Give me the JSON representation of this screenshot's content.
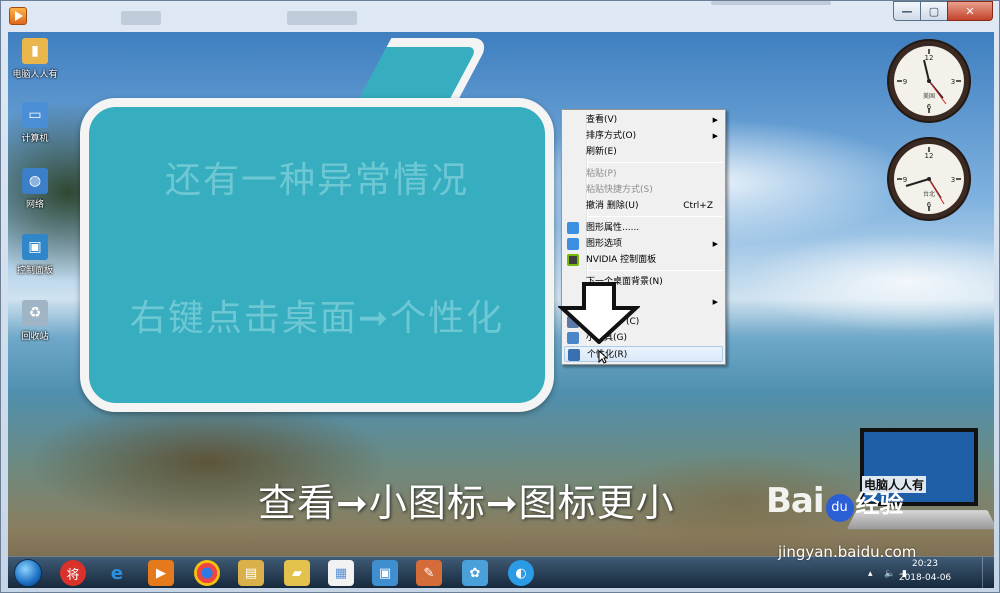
{
  "desktop_icons": [
    {
      "label": "电脑人人有",
      "icon": "folder-icon",
      "color": "#e8b64a"
    },
    {
      "label": "计算机",
      "icon": "computer-icon",
      "color": "#4a8ed6"
    },
    {
      "label": "网络",
      "icon": "network-icon",
      "color": "#3c7fc9"
    },
    {
      "label": "控制面板",
      "icon": "control-panel-icon",
      "color": "#2f86c8"
    },
    {
      "label": "回收站",
      "icon": "recycle-bin-icon",
      "color": "#9fb4c4"
    }
  ],
  "bubble": {
    "line1": "还有一种异常情况",
    "line2": "右键点击桌面➞个性化"
  },
  "context_menu": {
    "items": [
      {
        "label": "查看(V)",
        "submenu": true
      },
      {
        "label": "排序方式(O)",
        "submenu": true
      },
      {
        "label": "刷新(E)"
      },
      {
        "label": "粘贴(P)",
        "disabled": true
      },
      {
        "label": "粘贴快捷方式(S)",
        "disabled": true
      },
      {
        "label": "撤消 删除(U)",
        "shortcut": "Ctrl+Z"
      },
      {
        "label": "图形属性......",
        "icon": "graphics-properties-icon"
      },
      {
        "label": "图形选项",
        "icon": "graphics-options-icon",
        "submenu": true
      },
      {
        "label": "NVIDIA 控制面板",
        "icon": "nvidia-icon"
      },
      {
        "label": "下一个桌面背景(N)"
      },
      {
        "label": "",
        "submenu": true
      },
      {
        "label": "(C)"
      },
      {
        "label": "小工具(G)"
      },
      {
        "label": "个性化(R)",
        "highlighted": true
      }
    ]
  },
  "clock_labels": [
    "美国",
    "台北"
  ],
  "caption": "查看➞小图标➞图标更小",
  "laptop_text": "电脑人人有",
  "taskbar": {
    "apps": [
      {
        "name": "start-orb"
      },
      {
        "name": "jiang-app",
        "glyph": "将",
        "color": "#d8322a"
      },
      {
        "name": "ie-app",
        "glyph": "e",
        "color": "#2b8fe0"
      },
      {
        "name": "media-player-app",
        "glyph": "▶",
        "color": "#e57a1c"
      },
      {
        "name": "chrome-app",
        "glyph": "◉",
        "color": "#d8a72a"
      },
      {
        "name": "explorer-app",
        "glyph": "▤",
        "color": "#d9b04a"
      },
      {
        "name": "notes-app",
        "glyph": "▰",
        "color": "#e2c14c"
      },
      {
        "name": "document-app",
        "glyph": "▦",
        "color": "#5c8ed2"
      },
      {
        "name": "control-panel-app",
        "glyph": "▣",
        "color": "#3f8ed0"
      },
      {
        "name": "paint-app",
        "glyph": "✎",
        "color": "#d46c3a"
      },
      {
        "name": "puzzle-app",
        "glyph": "✿",
        "color": "#4aa0d8"
      },
      {
        "name": "browser-app",
        "glyph": "◐",
        "color": "#2c9be6"
      }
    ],
    "time": "20:23",
    "date": "2018-04-06"
  },
  "watermark": {
    "logo_prefix": "Bai",
    "logo_paw": "du",
    "logo_suffix": "经验",
    "url": "jingyan.baidu.com"
  }
}
